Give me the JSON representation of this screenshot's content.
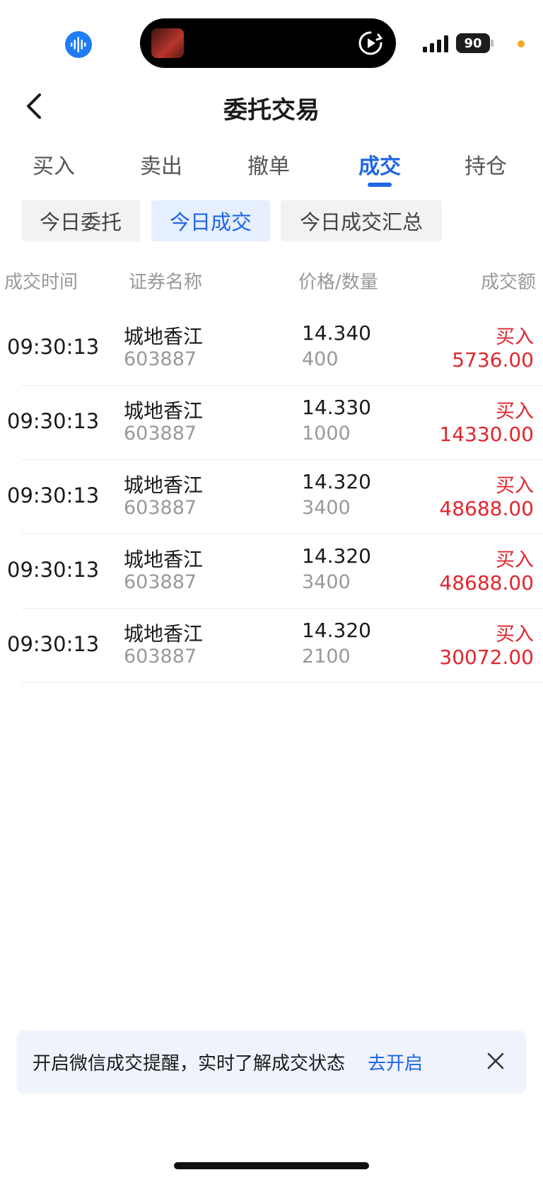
{
  "status_bar": {
    "battery": "90",
    "icons": [
      "voice-assistant-icon",
      "media-thumbnail",
      "play-icon",
      "signal-icon",
      "battery-icon"
    ],
    "accent_dot_color": "#f5a623"
  },
  "header": {
    "title": "委托交易",
    "back_icon": "chevron-left-icon"
  },
  "main_tabs": [
    {
      "label": "买入"
    },
    {
      "label": "卖出"
    },
    {
      "label": "撤单"
    },
    {
      "label": "成交",
      "active": true
    },
    {
      "label": "持仓"
    }
  ],
  "sub_tabs": [
    {
      "label": "今日委托"
    },
    {
      "label": "今日成交",
      "active": true
    },
    {
      "label": "今日成交汇总"
    }
  ],
  "table": {
    "headers": {
      "time": "成交时间",
      "name": "证券名称",
      "price_qty": "价格/数量",
      "amount": "成交额"
    },
    "rows": [
      {
        "time": "09:30:13",
        "name": "城地香江",
        "code": "603887",
        "price": "14.340",
        "qty": "400",
        "side": "买入",
        "amount": "5736.00"
      },
      {
        "time": "09:30:13",
        "name": "城地香江",
        "code": "603887",
        "price": "14.330",
        "qty": "1000",
        "side": "买入",
        "amount": "14330.00"
      },
      {
        "time": "09:30:13",
        "name": "城地香江",
        "code": "603887",
        "price": "14.320",
        "qty": "3400",
        "side": "买入",
        "amount": "48688.00"
      },
      {
        "time": "09:30:13",
        "name": "城地香江",
        "code": "603887",
        "price": "14.320",
        "qty": "3400",
        "side": "买入",
        "amount": "48688.00"
      },
      {
        "time": "09:30:13",
        "name": "城地香江",
        "code": "603887",
        "price": "14.320",
        "qty": "2100",
        "side": "买入",
        "amount": "30072.00"
      }
    ]
  },
  "notice": {
    "text": "开启微信成交提醒，实时了解成交状态",
    "link": "去开启",
    "close_icon": "close-icon"
  },
  "colors": {
    "accent": "#1f66e5",
    "buy_red": "#e0262e",
    "muted_text": "#999999"
  }
}
